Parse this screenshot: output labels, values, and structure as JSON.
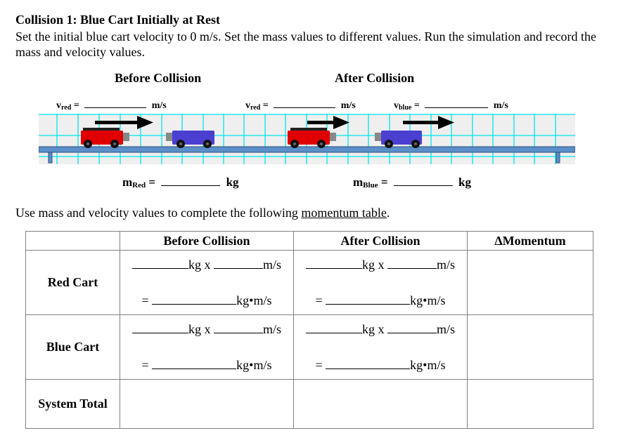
{
  "title": "Collision 1: Blue Cart Initially at Rest",
  "instructions": "Set the initial blue cart velocity to 0 m/s. Set the mass values to different values. Run the simulation and record the mass and velocity values.",
  "sections": {
    "before": "Before Collision",
    "after": "After Collision"
  },
  "velocity_labels": {
    "v": "v",
    "red_sub": "red",
    "blue_sub": "blue",
    "equals": "=",
    "unit": "m/s"
  },
  "mass_labels": {
    "m": "m",
    "red_sub": "Red",
    "blue_sub": "Blue",
    "equals": "=",
    "unit": "kg"
  },
  "momentum_instruction": {
    "prefix": "Use mass and velocity values to complete the following ",
    "link": "momentum table",
    "suffix": "."
  },
  "table": {
    "headers": [
      "",
      "Before Collision",
      "After Collision",
      "ΔMomentum"
    ],
    "rows": [
      {
        "label": "Red Cart"
      },
      {
        "label": "Blue Cart"
      },
      {
        "label": "System Total"
      }
    ],
    "formula": {
      "kg_x": "kg x",
      "ms": "m/s",
      "eq": "=",
      "kgms": "kg•m/s"
    }
  },
  "colors": {
    "red_cart": "#e00000",
    "blue_cart": "#4a3fd0",
    "grid": "#00e5ee",
    "track": "#5b8fc9",
    "sim_bg": "#efefef"
  }
}
